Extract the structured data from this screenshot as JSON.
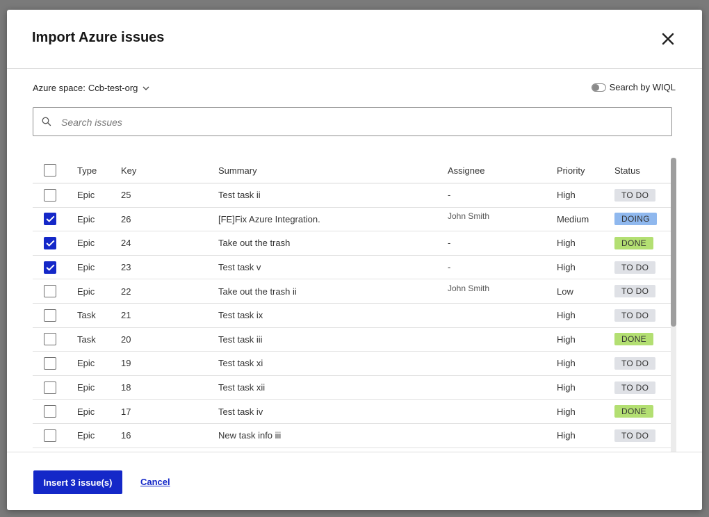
{
  "dialog": {
    "title": "Import Azure issues"
  },
  "space": {
    "label": "Azure space:",
    "value": "Ccb-test-org"
  },
  "wiql": {
    "label": "Search by WIQL",
    "enabled": false
  },
  "search": {
    "placeholder": "Search issues",
    "value": ""
  },
  "table": {
    "columns": [
      "Type",
      "Key",
      "Summary",
      "Assignee",
      "Priority",
      "Status"
    ],
    "header_checked": false,
    "rows": [
      {
        "checked": false,
        "type": "Epic",
        "key": "25",
        "summary": "Test task ii",
        "assignee": "-",
        "priority": "High",
        "status": "TO DO"
      },
      {
        "checked": true,
        "type": "Epic",
        "key": "26",
        "summary": "[FE]Fix Azure Integration.",
        "assignee": "John Smith",
        "priority": "Medium",
        "status": "DOING"
      },
      {
        "checked": true,
        "type": "Epic",
        "key": "24",
        "summary": "Take out the trash",
        "assignee": "-",
        "priority": "High",
        "status": "DONE"
      },
      {
        "checked": true,
        "type": "Epic",
        "key": "23",
        "summary": "Test task v",
        "assignee": "-",
        "priority": "High",
        "status": "TO DO"
      },
      {
        "checked": false,
        "type": "Epic",
        "key": "22",
        "summary": "Take out the trash ii",
        "assignee": "John Smith",
        "priority": "Low",
        "status": "TO DO"
      },
      {
        "checked": false,
        "type": "Task",
        "key": "21",
        "summary": "Test task ix",
        "assignee": "",
        "priority": "High",
        "status": "TO DO"
      },
      {
        "checked": false,
        "type": "Task",
        "key": "20",
        "summary": "Test task iii",
        "assignee": "",
        "priority": "High",
        "status": "DONE"
      },
      {
        "checked": false,
        "type": "Epic",
        "key": "19",
        "summary": "Test task xi",
        "assignee": "",
        "priority": "High",
        "status": "TO DO"
      },
      {
        "checked": false,
        "type": "Epic",
        "key": "18",
        "summary": "Test task xii",
        "assignee": "",
        "priority": "High",
        "status": "TO DO"
      },
      {
        "checked": false,
        "type": "Epic",
        "key": "17",
        "summary": "Test task iv",
        "assignee": "",
        "priority": "High",
        "status": "DONE"
      },
      {
        "checked": false,
        "type": "Epic",
        "key": "16",
        "summary": "New task info iii",
        "assignee": "",
        "priority": "High",
        "status": "TO DO"
      }
    ]
  },
  "status_colors": {
    "TO DO": "#dfe1e6",
    "DOING": "#8fb8ee",
    "DONE": "#b3df72"
  },
  "footer": {
    "insert_label": "Insert 3 issue(s)",
    "cancel_label": "Cancel"
  },
  "colors": {
    "accent": "#1428c8",
    "overlay": "#7a7a7a"
  },
  "icons": {
    "close": "close-icon",
    "search": "search-icon",
    "chevron": "chevron-down-icon",
    "check": "checkmark-icon"
  }
}
